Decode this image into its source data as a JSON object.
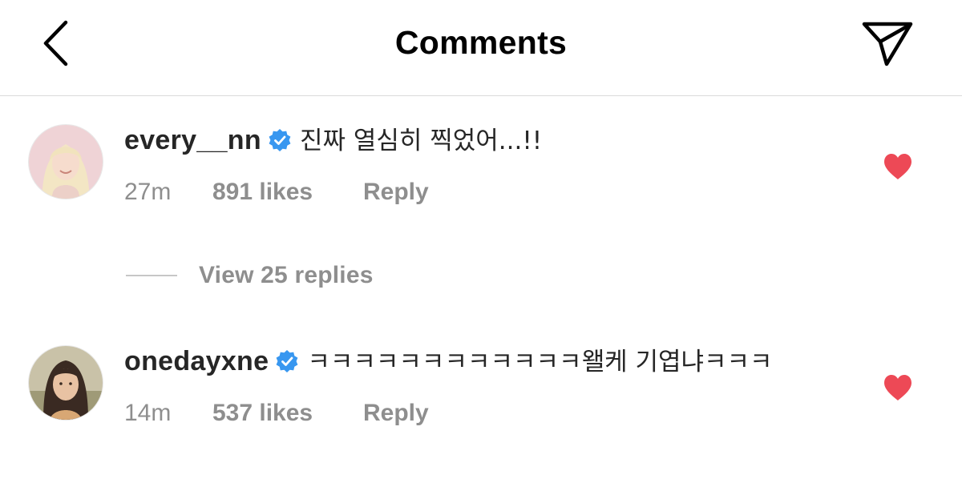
{
  "header": {
    "title": "Comments",
    "back_icon": "chevron-left-icon",
    "share_icon": "paper-plane-icon"
  },
  "comments": [
    {
      "username": "every__nn",
      "verified": true,
      "text": "진짜 열심히 찍었어...!!",
      "time": "27m",
      "likes": "891 likes",
      "reply": "Reply",
      "liked": true
    },
    {
      "username": "onedayxne",
      "verified": true,
      "text": "ㅋㅋㅋㅋㅋㅋㅋㅋㅋㅋㅋㅋ왤케 기엽냐ㅋㅋㅋ",
      "time": "14m",
      "likes": "537 likes",
      "reply": "Reply",
      "liked": true
    }
  ],
  "view_replies": "View 25 replies",
  "colors": {
    "heart": "#ed4956",
    "verified": "#3897f0",
    "muted": "#8e8e8e"
  }
}
